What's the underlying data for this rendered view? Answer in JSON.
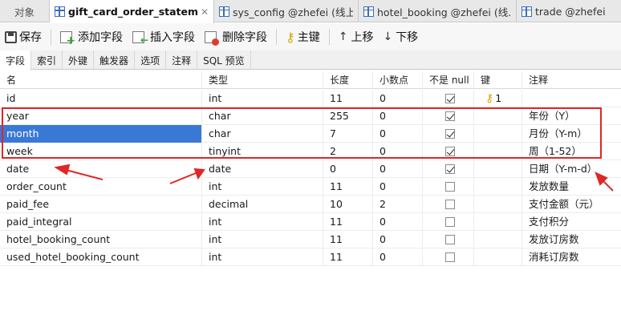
{
  "tabs": [
    {
      "label": "对象",
      "active": false
    },
    {
      "label": "gift_card_order_statement...",
      "active": true
    },
    {
      "label": "sys_config @zhefei (线上测...",
      "active": false
    },
    {
      "label": "hotel_booking @zhefei (线...",
      "active": false
    },
    {
      "label": "trade @zhefei",
      "active": false
    }
  ],
  "toolbar": {
    "save": "保存",
    "add_field": "添加字段",
    "insert_field": "插入字段",
    "delete_field": "删除字段",
    "primary_key": "主键",
    "move_up": "上移",
    "move_down": "下移"
  },
  "subtabs": [
    "字段",
    "索引",
    "外键",
    "触发器",
    "选项",
    "注释",
    "SQL 预览"
  ],
  "columns": {
    "name": "名",
    "type": "类型",
    "length": "长度",
    "decimals": "小数点",
    "not_null": "不是 null",
    "key": "键",
    "comment": "注释"
  },
  "rows": [
    {
      "name": "id",
      "type": "int",
      "length": "11",
      "decimals": "0",
      "not_null": true,
      "key": "1",
      "comment": ""
    },
    {
      "name": "year",
      "type": "char",
      "length": "255",
      "decimals": "0",
      "not_null": true,
      "key": "",
      "comment": "年份（Y）"
    },
    {
      "name": "month",
      "type": "char",
      "length": "7",
      "decimals": "0",
      "not_null": true,
      "key": "",
      "comment": "月份（Y-m）"
    },
    {
      "name": "week",
      "type": "tinyint",
      "length": "2",
      "decimals": "0",
      "not_null": true,
      "key": "",
      "comment": "周（1-52）"
    },
    {
      "name": "date",
      "type": "date",
      "length": "0",
      "decimals": "0",
      "not_null": true,
      "key": "",
      "comment": "日期（Y-m-d）"
    },
    {
      "name": "order_count",
      "type": "int",
      "length": "11",
      "decimals": "0",
      "not_null": false,
      "key": "",
      "comment": "发放数量"
    },
    {
      "name": "paid_fee",
      "type": "decimal",
      "length": "10",
      "decimals": "2",
      "not_null": false,
      "key": "",
      "comment": "支付金额（元）"
    },
    {
      "name": "paid_integral",
      "type": "int",
      "length": "11",
      "decimals": "0",
      "not_null": false,
      "key": "",
      "comment": "支付积分"
    },
    {
      "name": "hotel_booking_count",
      "type": "int",
      "length": "11",
      "decimals": "0",
      "not_null": false,
      "key": "",
      "comment": "发放订房数"
    },
    {
      "name": "used_hotel_booking_count",
      "type": "int",
      "length": "11",
      "decimals": "0",
      "not_null": false,
      "key": "",
      "comment": "消耗订房数"
    }
  ],
  "selected_row": 2,
  "colors": {
    "selection": "#3a78d6",
    "annotation": "#e02626",
    "key": "#d9a400"
  },
  "icons": [
    "table-icon",
    "close-icon",
    "save-icon",
    "add-field-icon",
    "insert-field-icon",
    "delete-field-icon",
    "key-icon",
    "arrow-up-icon",
    "arrow-down-icon",
    "checkbox-icon"
  ]
}
